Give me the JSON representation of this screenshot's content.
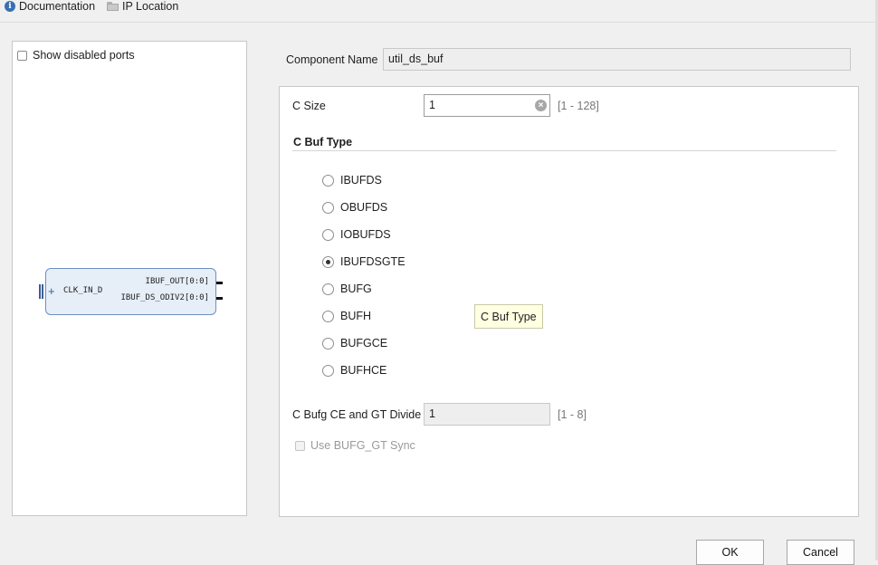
{
  "toolbar": {
    "documentation": "Documentation",
    "ip_location": "IP Location"
  },
  "symbol": {
    "show_disabled_ports": "Show disabled ports",
    "input_port": "CLK_IN_D",
    "output_ports": [
      "IBUF_OUT[0:0]",
      "IBUF_DS_ODIV2[0:0]"
    ]
  },
  "config": {
    "component_name_label": "Component Name",
    "component_name_value": "util_ds_buf",
    "c_size_label": "C Size",
    "c_size_value": "1",
    "c_size_range": "[1 - 128]",
    "buf_type_title": "C Buf Type",
    "buf_types": [
      "IBUFDS",
      "OBUFDS",
      "IOBUFDS",
      "IBUFDSGTE",
      "BUFG",
      "BUFH",
      "BUFGCE",
      "BUFHCE"
    ],
    "selected_buf_type": "IBUFDSGTE",
    "tooltip": "C Buf Type",
    "bufg_ce_label": "C Bufg CE and GT Divide",
    "bufg_ce_value": "1",
    "bufg_ce_range": "[1 - 8]",
    "use_bufg_gt_sync": "Use BUFG_GT Sync"
  },
  "buttons": {
    "ok": "OK",
    "cancel": "Cancel"
  }
}
